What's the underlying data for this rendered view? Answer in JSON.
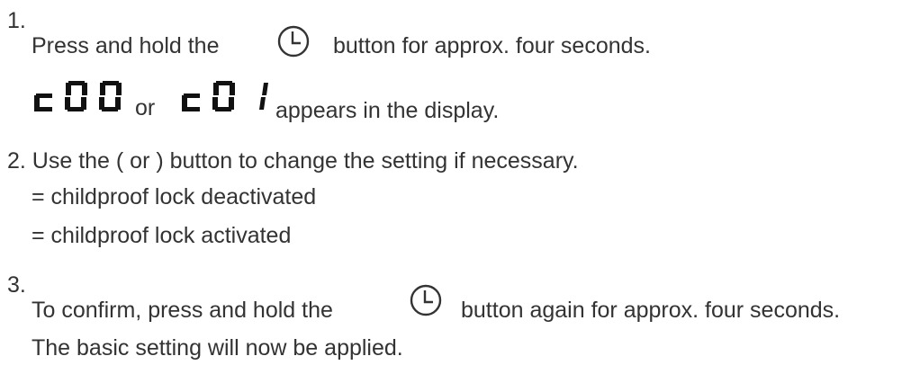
{
  "step1": {
    "number": "1.",
    "text_before": "Press and hold the",
    "icon": "clock-icon",
    "text_after": "button for approx. four seconds.",
    "display_a": "c00",
    "or": "or",
    "display_b": "c01",
    "appears": "appears in the display."
  },
  "step2": {
    "text": "2. Use the ( or ) button to change the setting if necessary.",
    "option_off": "= childproof lock deactivated",
    "option_on": "= childproof lock activated"
  },
  "step3": {
    "number": "3.",
    "text_before": "To confirm, press and hold the",
    "icon": "clock-icon",
    "text_after": "button again for approx. four seconds.",
    "note": "The basic setting will now be applied."
  }
}
